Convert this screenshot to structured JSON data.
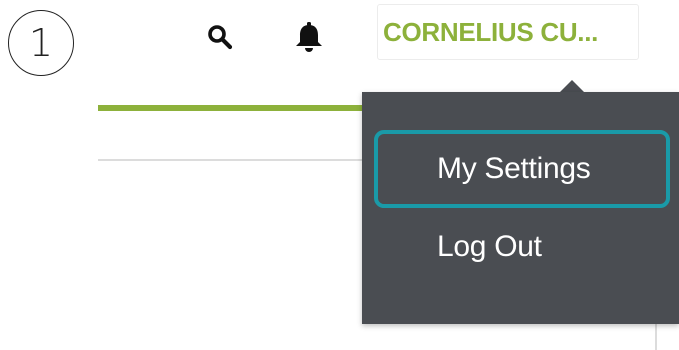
{
  "step": {
    "number": "1"
  },
  "header": {
    "icons": {
      "search": "search-icon",
      "notifications": "bell-icon"
    },
    "user": {
      "display_name": "CORNELIUS CU..."
    }
  },
  "user_menu": {
    "items": [
      {
        "label": "My Settings",
        "highlighted": true
      },
      {
        "label": "Log Out",
        "highlighted": false
      }
    ]
  },
  "colors": {
    "accent_green": "#8db13b",
    "menu_background": "#4a4d52",
    "highlight_outline": "#1a9aa8"
  }
}
